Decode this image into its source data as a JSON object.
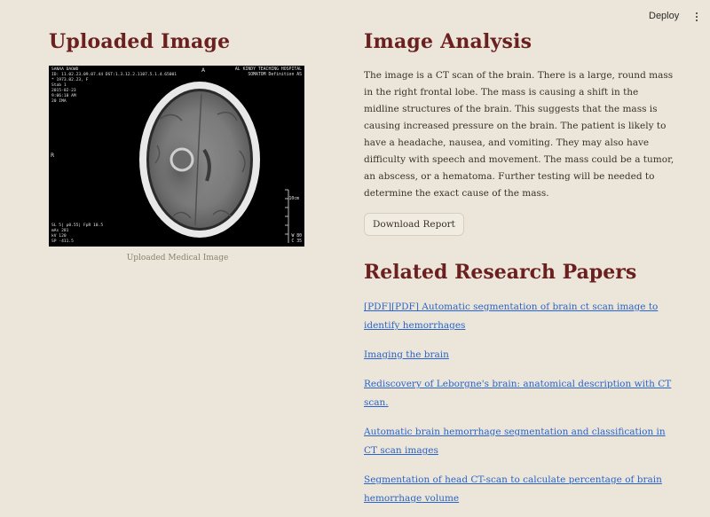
{
  "header": {
    "deploy_label": "Deploy"
  },
  "left": {
    "title": "Uploaded Image",
    "caption": "Uploaded Medical Image",
    "scan": {
      "overlay_top_left": [
        "SANAA DAOWD",
        "ID: 11.02.23.09.07.44 DST:1.3.12.2.1107.5.1.4.65001",
        "* 1973.02.23, F",
        "Stab 1",
        "2015-02-23",
        "9:06:18 AM",
        "20 IMA"
      ],
      "overlay_top_right": [
        "AL KINDY TEACHING HOSPITAL",
        "SOMATOM Definition AS"
      ],
      "marker_top": "A",
      "marker_left": "R",
      "scale_label": "10cm",
      "overlay_bottom_left": [
        "SL 5| p0.55| FpR 10.5",
        "mAs 281",
        "kV 120",
        "SP -411.5"
      ],
      "overlay_bottom_right": [
        "W 80",
        "C 35"
      ]
    }
  },
  "right": {
    "analysis_title": "Image Analysis",
    "analysis_text": "The image is a CT scan of the brain. There is a large, round mass in the right frontal lobe. The mass is causing a shift in the midline structures of the brain. This suggests that the mass is causing increased pressure on the brain. The patient is likely to have a headache, nausea, and vomiting. They may also have difficulty with speech and movement. The mass could be a tumor, an abscess, or a hematoma. Further testing will be needed to determine the exact cause of the mass.",
    "download_label": "Download Report",
    "papers_title": "Related Research Papers",
    "papers": [
      "[PDF][PDF] Automatic segmentation of brain ct scan image to identify hemorrhages",
      "Imaging the brain",
      "Rediscovery of Leborgne's brain: anatomical description with CT scan.",
      "Automatic brain hemorrhage segmentation and classification in CT scan images",
      "Segmentation of head CT-scan to calculate percentage of brain hemorrhage volume"
    ]
  },
  "colors": {
    "background": "#ece6da",
    "heading": "#6b2020",
    "link": "#2a64c8"
  }
}
